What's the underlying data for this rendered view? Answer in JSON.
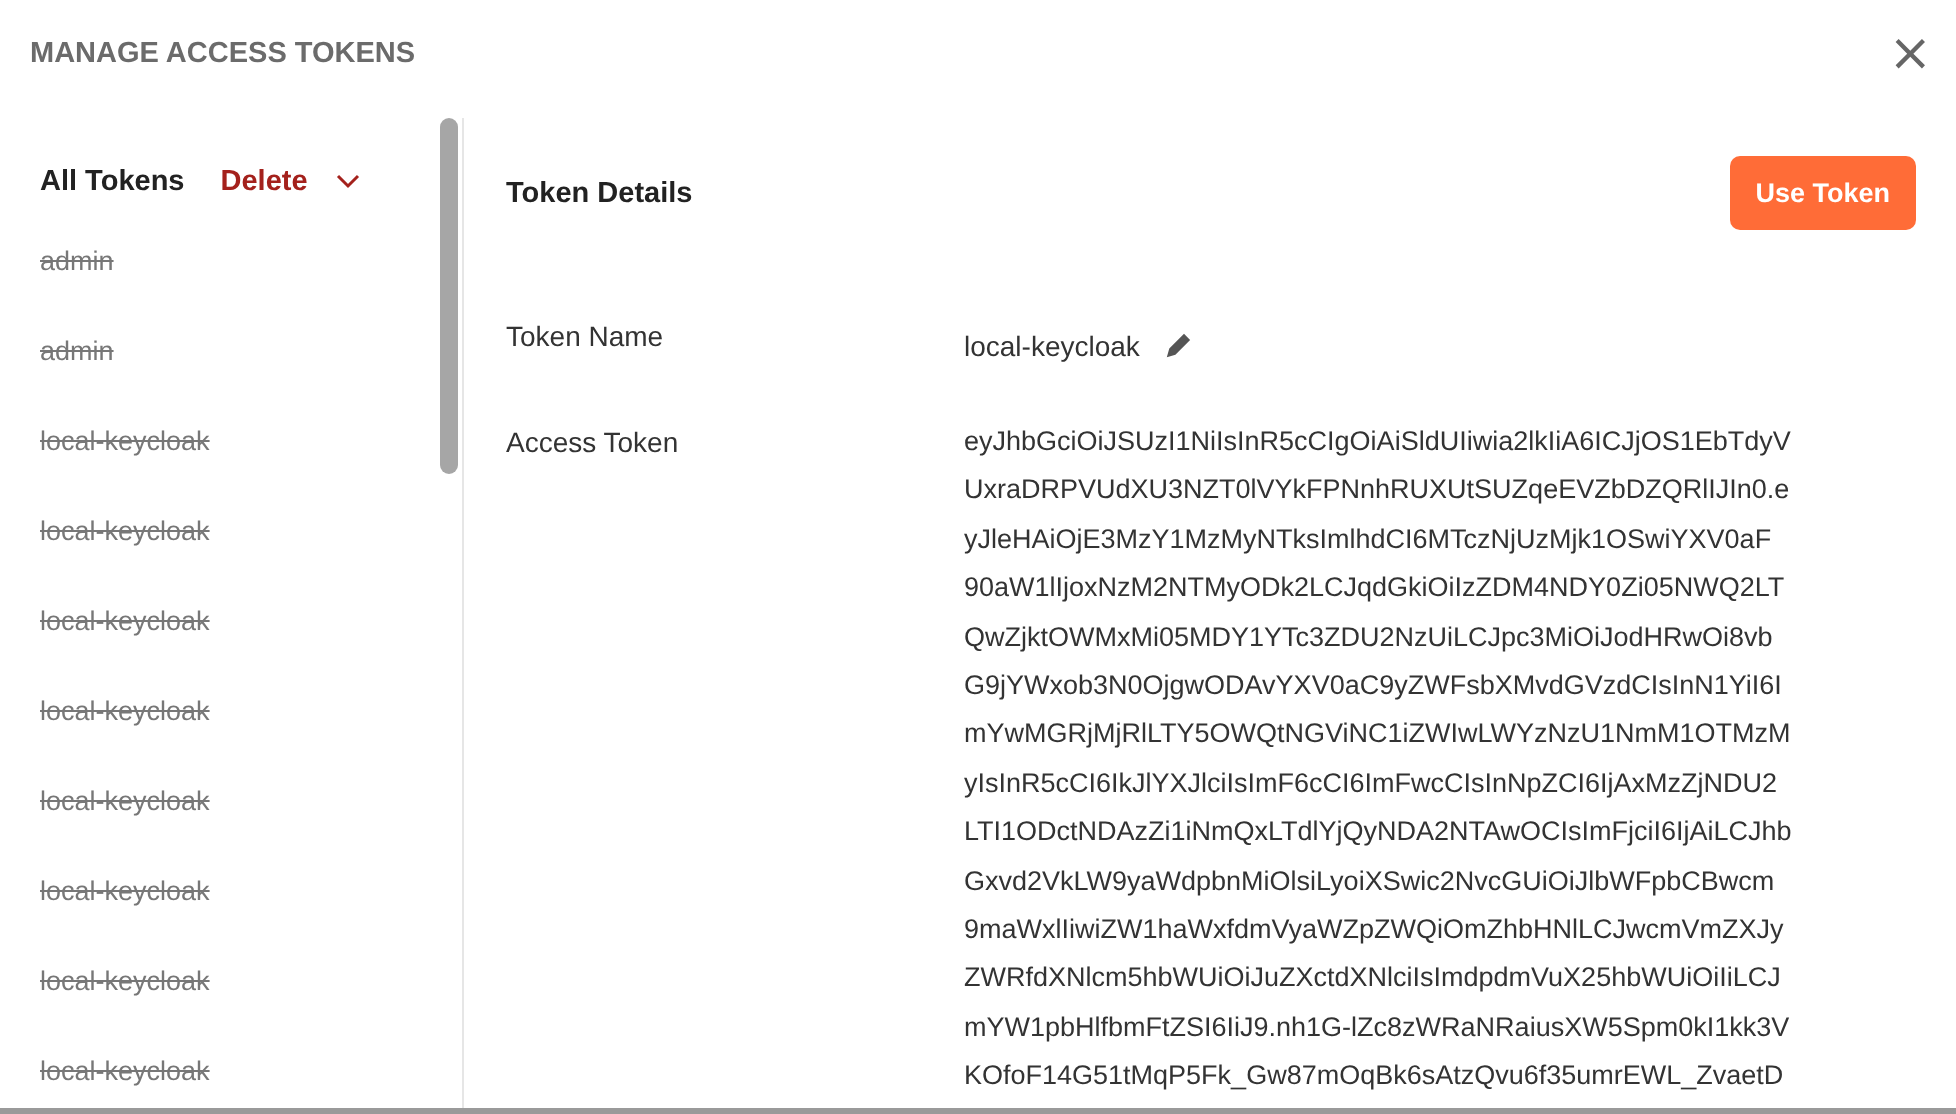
{
  "window": {
    "title": "MANAGE ACCESS TOKENS",
    "close": "×"
  },
  "sidebar": {
    "heading": "All Tokens",
    "delete_label": "Delete",
    "items": [
      {
        "label": "admin",
        "expired": true
      },
      {
        "label": "admin",
        "expired": true
      },
      {
        "label": "local-keycloak",
        "expired": true
      },
      {
        "label": "local-keycloak",
        "expired": true
      },
      {
        "label": "local-keycloak",
        "expired": true
      },
      {
        "label": "local-keycloak",
        "expired": true
      },
      {
        "label": "local-keycloak",
        "expired": true
      },
      {
        "label": "local-keycloak",
        "expired": true
      },
      {
        "label": "local-keycloak",
        "expired": true
      },
      {
        "label": "local-keycloak",
        "expired": true
      }
    ]
  },
  "details": {
    "heading": "Token Details",
    "use_button": "Use Token",
    "fields": [
      {
        "label": "Token Name",
        "value": "local-keycloak",
        "editable": true
      }
    ],
    "access_token": {
      "label": "Access Token",
      "lines": [
        "eyJhbGciOiJSUzI1NiIsInR5cCIgOiAiSldUIiwia2lkIiA6ICJjOS1EbTdyV",
        "UxraDRPVUdXU3NZT0lVYkFPNnhRUXUtSUZqeEVZbDZQRlIJIn0.e",
        "yJleHAiOjE3MzY1MzMyNTksImlhdCI6MTczNjUzMjk1OSwiYXV0aF",
        "90aW1lIjoxNzM2NTMyODk2LCJqdGkiOiIzZDM4NDY0Zi05NWQ2LT",
        "QwZjktOWMxMi05MDY1YTc3ZDU2NzUiLCJpc3MiOiJodHRwOi8vb",
        "G9jYWxob3N0OjgwODAvYXV0aC9yZWFsbXMvdGVzdCIsInN1YiI6I",
        "mYwMGRjMjRlLTY5OWQtNGViNC1iZWIwLWYzNzU1NmM1OTMzM",
        "yIsInR5cCI6IkJlYXJlciIsImF6cCI6ImFwcCIsInNpZCI6IjAxMzZjNDU2",
        "LTI1ODctNDAzZi1iNmQxLTdlYjQyNDA2NTAwOCIsImFjciI6IjAiLCJhb",
        "Gxvd2VkLW9yaWdpbnMiOlsiLyoiXSwic2NvcGUiOiJlbWFpbCBwcm",
        "9maWxlIiwiZW1haWxfdmVyaWZpZWQiOmZhbHNlLCJwcmVmZXJy",
        "ZWRfdXNlcm5hbWUiOiJuZXctdXNlciIsImdpdmVuX25hbWUiOiIiLCJ",
        "mYW1pbHlfbmFtZSI6IiJ9.nh1G-lZc8zWRaNRaiusXW5Spm0kI1kk3V",
        "KOfoF14G51tMqP5Fk_Gw87mOqBk6sAtzQvu6f35umrEWL_ZvaetD"
      ]
    }
  }
}
